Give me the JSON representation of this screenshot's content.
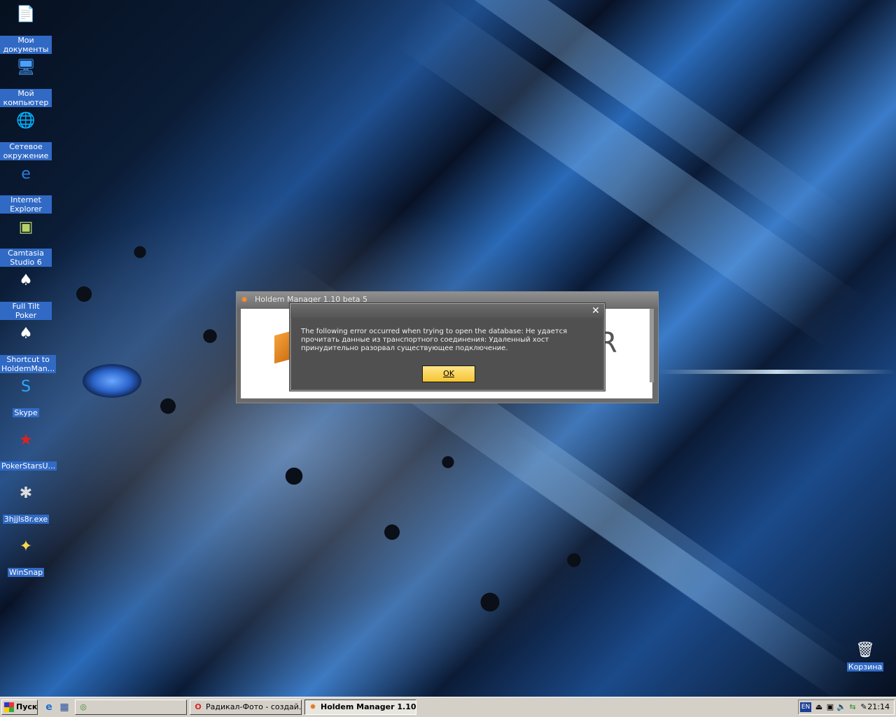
{
  "desktop": {
    "icons": [
      {
        "label": "Мои документы",
        "glyph": "📄",
        "icon": "my-documents-icon"
      },
      {
        "label": "Мой компьютер",
        "glyph": "🖥",
        "icon": "my-computer-icon"
      },
      {
        "label": "Сетевое окружение",
        "glyph": "🌐",
        "icon": "network-places-icon"
      },
      {
        "label": "Internet Explorer",
        "glyph": "e",
        "icon": "internet-explorer-icon"
      },
      {
        "label": "Camtasia Studio 6",
        "glyph": "▣",
        "icon": "camtasia-icon"
      },
      {
        "label": "Full Tilt Poker",
        "glyph": "♠",
        "icon": "full-tilt-poker-icon"
      },
      {
        "label": "Shortcut to HoldemMan...",
        "glyph": "♠",
        "icon": "holdem-manager-shortcut-icon"
      },
      {
        "label": "Skype",
        "glyph": "S",
        "icon": "skype-icon"
      },
      {
        "label": "PokerStarsU...",
        "glyph": "★",
        "icon": "pokerstars-icon"
      },
      {
        "label": "3hjjls8r.exe",
        "glyph": "✱",
        "icon": "exe-icon"
      },
      {
        "label": "WinSnap",
        "glyph": "✦",
        "icon": "winsnap-icon"
      }
    ],
    "recycle_bin": {
      "label": "Корзина",
      "glyph": "🗑",
      "icon": "recycle-bin-icon"
    }
  },
  "hm_window": {
    "title": "Holdem Manager 1.10 beta 5",
    "logo_letter": "R"
  },
  "error_dialog": {
    "close_glyph": "✕",
    "message": "The following error occurred when trying to open the database: Не удается прочитать данные из транспортного соединения: Удаленный хост принудительно разорвал существующее подключение.",
    "ok_label": "OK"
  },
  "taskbar": {
    "start_label": "Пуск",
    "quicklaunch": [
      {
        "glyph": "e",
        "icon": "ie-quicklaunch-icon"
      },
      {
        "glyph": "▦",
        "icon": "show-desktop-icon"
      }
    ],
    "tasks": [
      {
        "label": "",
        "glyph": "◎",
        "icon": "app-tray-icon"
      },
      {
        "label": "Радикал-Фото - создай...",
        "glyph": "O",
        "icon": "opera-icon"
      },
      {
        "label": "Holdem Manager 1.10...",
        "glyph": "✹",
        "icon": "holdem-manager-icon"
      }
    ],
    "tray": {
      "lang": "EN",
      "clock": "21:14"
    }
  }
}
